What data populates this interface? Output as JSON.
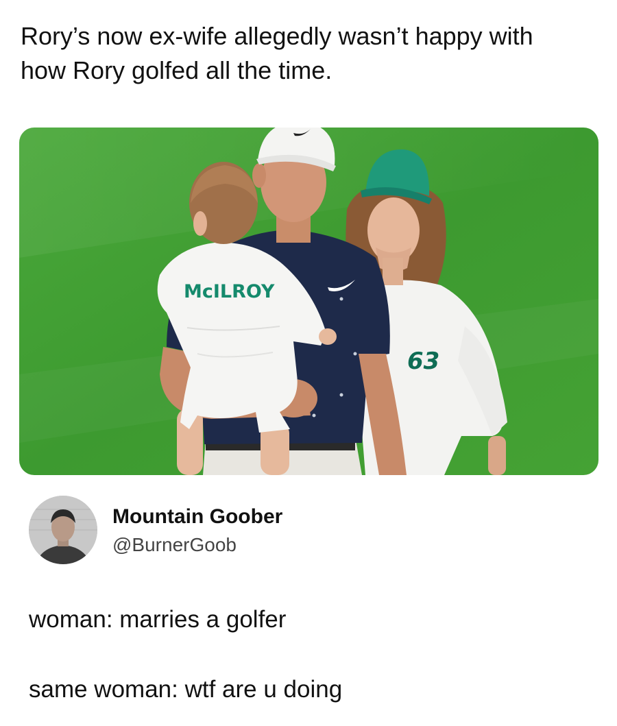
{
  "caption": {
    "line1": "Rory’s now ex-wife allegedly wasn’t happy with",
    "line2": "how Rory golfed all the time."
  },
  "photo": {
    "shirt_back_text": "McILROY",
    "bib_number": "63",
    "grass_color": "#3f9a2f",
    "cap_green": "#1f9a7a"
  },
  "tweet": {
    "author_name": "Mountain Goober",
    "author_handle": "@BurnerGoob",
    "lines": [
      "woman: marries a golfer",
      "same woman: wtf are u doing"
    ]
  }
}
